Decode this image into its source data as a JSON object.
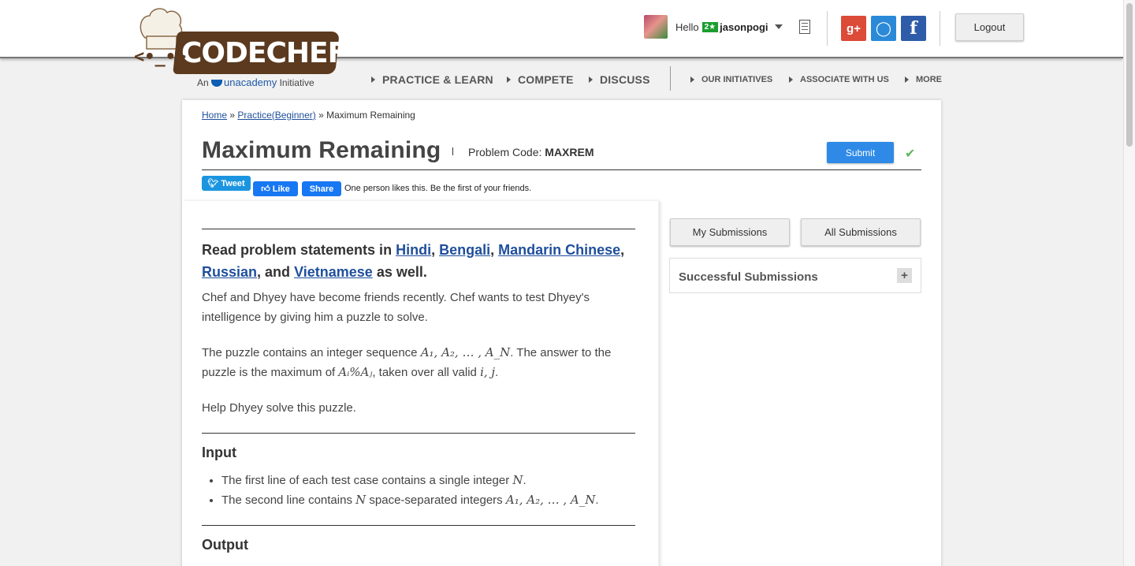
{
  "brand": {
    "logo_text": "CODECHEF",
    "sub_prefix": "An",
    "sub_brand": "unacademy",
    "sub_suffix": "Initiative"
  },
  "user": {
    "greeting": "Hello",
    "stars": "2★",
    "username": "jasonpogi"
  },
  "header": {
    "logout_label": "Logout",
    "social": {
      "google": "g+",
      "github": "◯",
      "facebook": "f"
    }
  },
  "nav": {
    "main": [
      "PRACTICE & LEARN",
      "COMPETE",
      "DISCUSS"
    ],
    "secondary": [
      "OUR INITIATIVES",
      "ASSOCIATE WITH US",
      "MORE"
    ]
  },
  "breadcrumb": {
    "home": "Home",
    "practice": "Practice(Beginner)",
    "current": "Maximum Remaining",
    "sep": "»"
  },
  "problem": {
    "title": "Maximum Remaining",
    "code_label": "Problem Code:",
    "code": "MAXREM",
    "submit_label": "Submit",
    "languages_prefix": "Read problem statements in",
    "languages": [
      "Hindi",
      "Bengali",
      "Mandarin Chinese",
      "Russian",
      "Vietnamese"
    ],
    "languages_and": ", and",
    "languages_suffix": "as well.",
    "para1": "Chef and Dhyey have become friends recently. Chef wants to test Dhyey's intelligence by giving him a puzzle to solve.",
    "para2_a": "The puzzle contains an integer sequence",
    "para2_seq": "A₁, A₂, … , A_N",
    "para2_b": ". The answer to the puzzle is the maximum of",
    "para2_expr": "Aᵢ%Aⱼ",
    "para2_c": ", taken over all valid",
    "para2_ij": "i, j",
    "para2_d": ".",
    "para3": "Help Dhyey solve this puzzle.",
    "input_heading": "Input",
    "input_items": [
      {
        "text": "The first line of each test case contains a single integer",
        "math": "N",
        "end": "."
      },
      {
        "text_a": "The second line contains",
        "math_a": "N",
        "text_b": "space-separated integers",
        "math_b": "A₁, A₂, … , A_N",
        "end": "."
      }
    ],
    "output_heading": "Output"
  },
  "social_share": {
    "tweet_label": "Tweet",
    "like_label": "Like",
    "share_label": "Share",
    "likes_text": "One person likes this. Be the first of your friends."
  },
  "sidebar": {
    "my_submissions": "My Submissions",
    "all_submissions": "All Submissions",
    "successful_submissions": "Successful Submissions",
    "expand": "+"
  }
}
